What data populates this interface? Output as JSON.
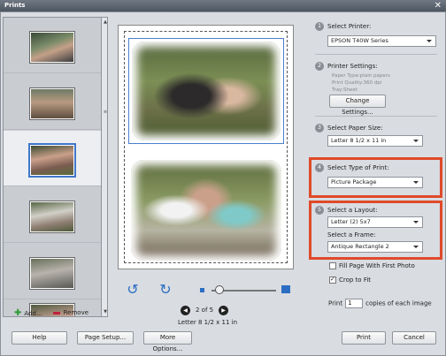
{
  "window": {
    "title": "Prints"
  },
  "thumbnails": [
    {
      "name": "thumb-1",
      "style": "p1",
      "selected": false
    },
    {
      "name": "thumb-2",
      "style": "p2",
      "selected": false
    },
    {
      "name": "thumb-3",
      "style": "p3",
      "selected": true
    },
    {
      "name": "thumb-4",
      "style": "p4",
      "selected": false
    },
    {
      "name": "thumb-5",
      "style": "p5",
      "selected": false
    },
    {
      "name": "thumb-6",
      "style": "p6",
      "selected": false
    }
  ],
  "left": {
    "add_label": "Add...",
    "remove_label": "Remove"
  },
  "preview": {
    "page_indicator": "2 of 5",
    "paper_size_label": "Letter 8 1/2 x 11 in"
  },
  "settings": {
    "step1": {
      "num": "1",
      "label": "Select Printer:",
      "value": "EPSON T40W Series"
    },
    "step2": {
      "num": "2",
      "label": "Printer Settings:",
      "paper_type": "Paper Type:plain papers",
      "print_quality": "Print Quality:360 dpi",
      "tray": "Tray:Sheet",
      "button": "Change Settings..."
    },
    "step3": {
      "num": "3",
      "label": "Select Paper Size:",
      "value": "Letter 8 1/2 x 11 in"
    },
    "step4": {
      "num": "4",
      "label": "Select Type of Print:",
      "value": "Picture Package"
    },
    "step5": {
      "num": "5",
      "label": "Select a Layout:",
      "value": "Letter (2) 5x7",
      "frame_label": "Select a Frame:",
      "frame_value": "Antique Rectangle 2"
    },
    "fill_page": "Fill Page With First Photo",
    "crop_to_fit": "Crop to Fit",
    "copies": {
      "prefix": "Print",
      "value": "1",
      "suffix": "copies of each image"
    }
  },
  "buttons": {
    "help": "Help",
    "page_setup": "Page Setup...",
    "more_options": "More Options...",
    "print": "Print",
    "cancel": "Cancel"
  },
  "colors": {
    "highlight": "#e04a2a",
    "accent": "#2b6ec3"
  }
}
